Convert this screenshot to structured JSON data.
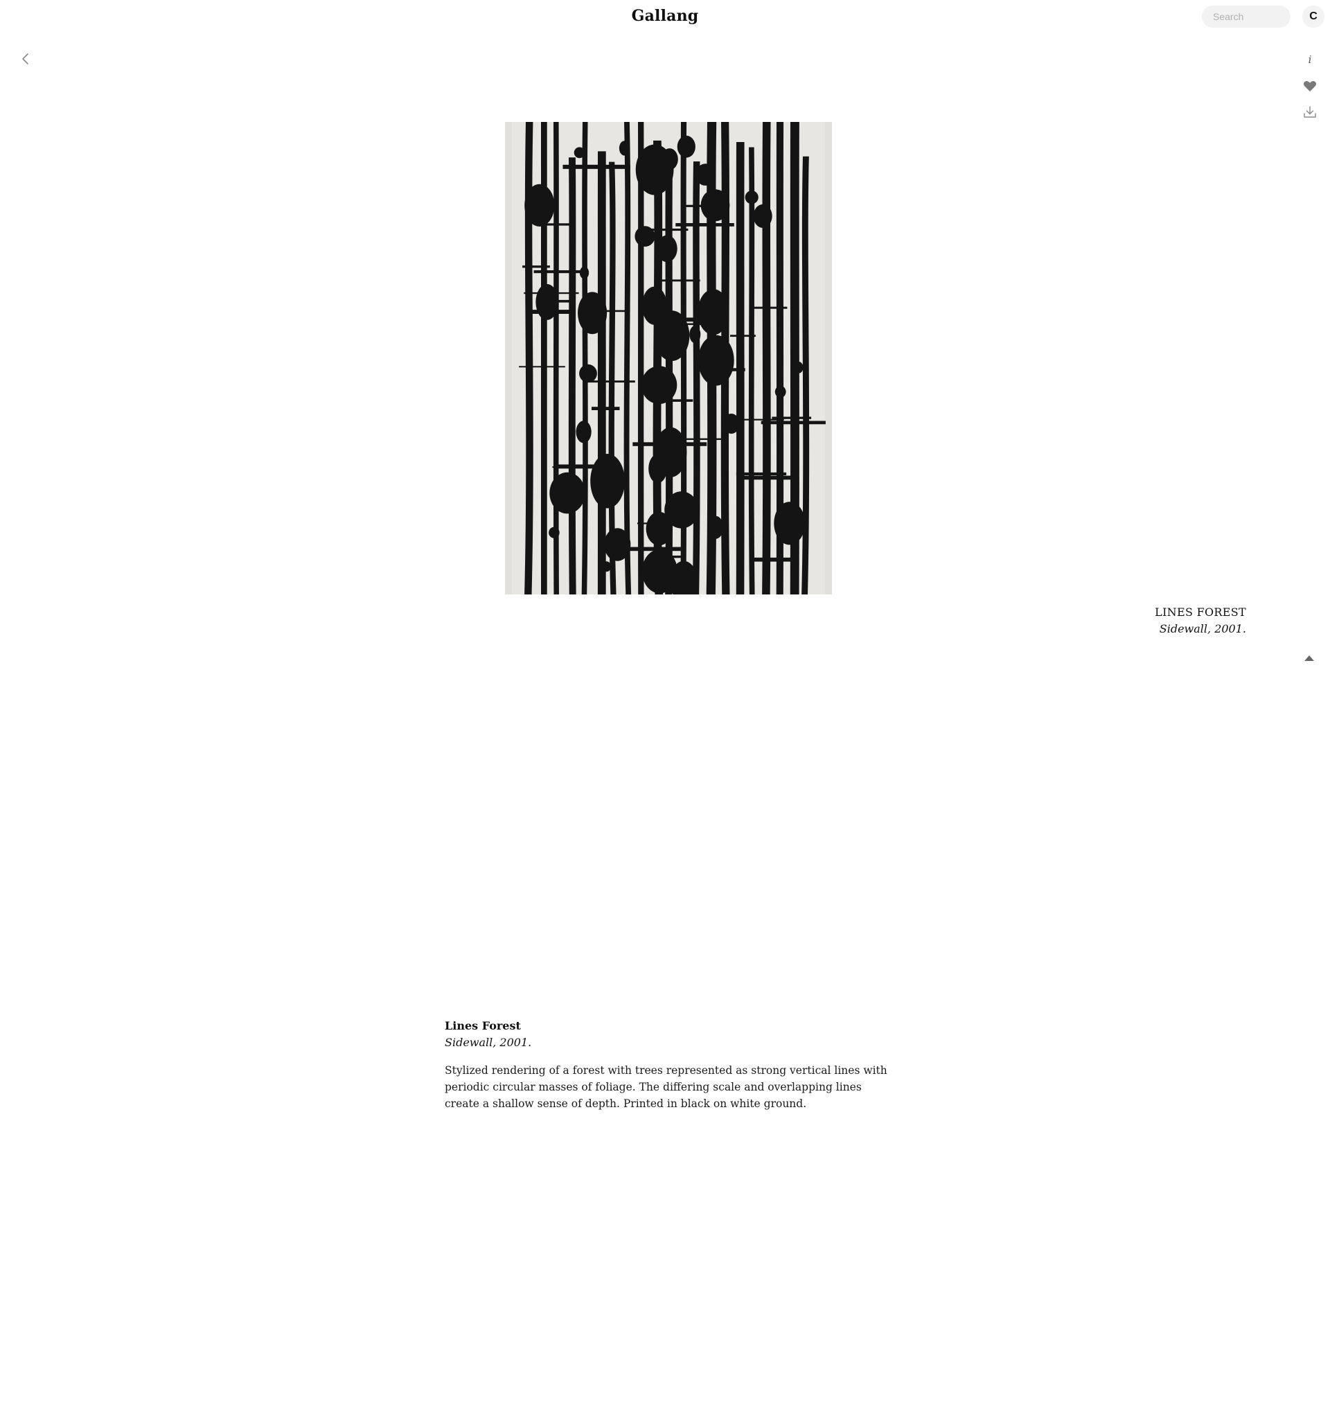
{
  "header": {
    "brand": "Gallang",
    "search_placeholder": "Search",
    "avatar_initial": "C"
  },
  "side_actions": {
    "info_label": "i"
  },
  "caption": {
    "title": "LINES FOREST",
    "subtitle": "Sidewall, 2001."
  },
  "details": {
    "title": "Lines Forest",
    "subtitle": "Sidewall, 2001.",
    "description": "Stylized rendering of a forest with trees represented as strong vertical lines with periodic circular masses of foliage. The differing scale and overlapping lines create a shallow sense of depth. Printed in black on white ground."
  },
  "colors": {
    "background": "#ffffff",
    "artwork_ground": "#e1e0dc",
    "artwork_ink": "#141414",
    "icon_gray": "#777777"
  }
}
